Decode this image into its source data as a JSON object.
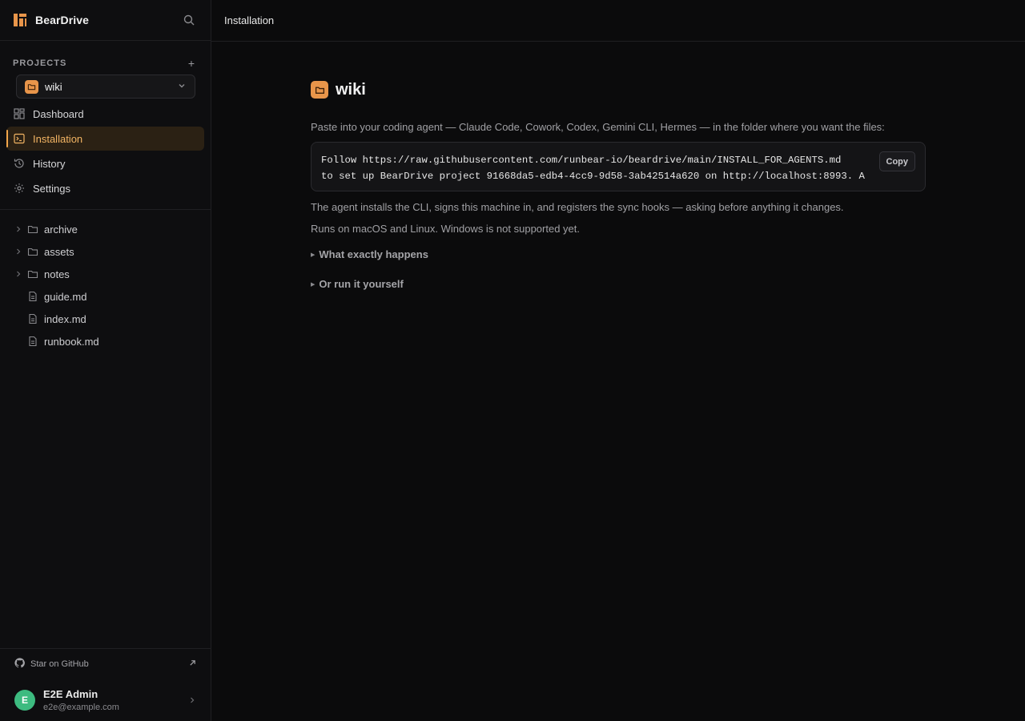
{
  "app": {
    "name": "BearDrive"
  },
  "sidebar": {
    "projects_label": "PROJECTS",
    "add_label": "+",
    "selected_project": "wiki",
    "nav": [
      {
        "label": "Dashboard",
        "icon": "dashboard-icon"
      },
      {
        "label": "Installation",
        "icon": "terminal-icon",
        "active": true
      },
      {
        "label": "History",
        "icon": "history-icon"
      },
      {
        "label": "Settings",
        "icon": "gear-icon"
      }
    ],
    "tree": [
      {
        "name": "archive",
        "type": "folder"
      },
      {
        "name": "assets",
        "type": "folder"
      },
      {
        "name": "notes",
        "type": "folder"
      },
      {
        "name": "guide.md",
        "type": "file"
      },
      {
        "name": "index.md",
        "type": "file"
      },
      {
        "name": "runbook.md",
        "type": "file"
      }
    ],
    "star_github": "Star on GitHub",
    "user": {
      "initial": "E",
      "name": "E2E Admin",
      "email": "e2e@example.com"
    }
  },
  "topbar": {
    "title": "Installation"
  },
  "content": {
    "title": "wiki",
    "lead": "Paste into your coding agent — Claude Code, Cowork, Codex, Gemini CLI, Hermes — in the folder where you want the files:",
    "code": {
      "line1": "Follow https://raw.githubusercontent.com/runbear-io/beardrive/main/INSTALL_FOR_AGENTS.md",
      "line2": "to set up BearDrive project 91668da5-edb4-4cc9-9d58-3ab42514a620 on http://localhost:8993. A"
    },
    "copy_label": "Copy",
    "para1": "The agent installs the CLI, signs this machine in, and registers the sync hooks — asking before anything it changes.",
    "para2": "Runs on macOS and Linux. Windows is not supported yet.",
    "details1": "What exactly happens",
    "details2": "Or run it yourself"
  },
  "colors": {
    "accent": "#e8954a",
    "active_text": "#f2b463",
    "avatar": "#3dbb80"
  }
}
